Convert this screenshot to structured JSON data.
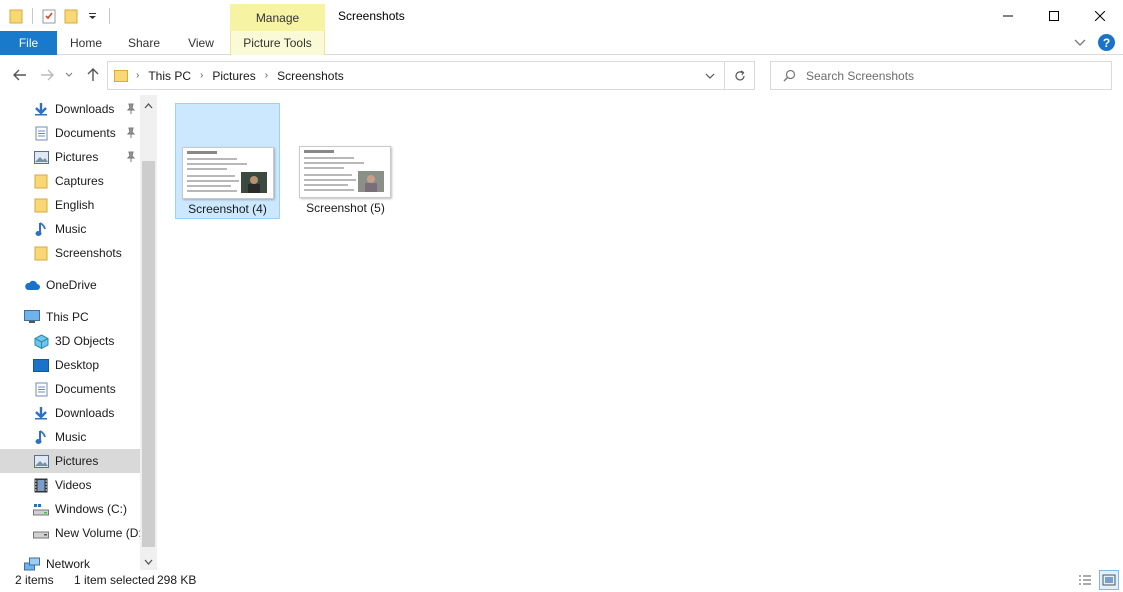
{
  "window": {
    "title": "Screenshots",
    "contextual_group": "Manage"
  },
  "ribbon": {
    "tabs": {
      "file": "File",
      "home": "Home",
      "share": "Share",
      "view": "View",
      "picture_tools": "Picture Tools"
    }
  },
  "address": {
    "crumbs": [
      "This PC",
      "Pictures",
      "Screenshots"
    ]
  },
  "search": {
    "placeholder": "Search Screenshots"
  },
  "sidebar": {
    "quick_access": [
      {
        "label": "Downloads",
        "icon": "download-arrow-icon",
        "pinned": true
      },
      {
        "label": "Documents",
        "icon": "document-icon",
        "pinned": true
      },
      {
        "label": "Pictures",
        "icon": "pictures-icon",
        "pinned": true
      },
      {
        "label": "Captures",
        "icon": "folder-icon",
        "pinned": false
      },
      {
        "label": "English",
        "icon": "folder-icon",
        "pinned": false
      },
      {
        "label": "Music",
        "icon": "music-note-icon",
        "pinned": false
      },
      {
        "label": "Screenshots",
        "icon": "folder-icon",
        "pinned": false
      }
    ],
    "onedrive": "OneDrive",
    "this_pc": "This PC",
    "this_pc_items": [
      {
        "label": "3D Objects",
        "icon": "cube-icon"
      },
      {
        "label": "Desktop",
        "icon": "desktop-icon"
      },
      {
        "label": "Documents",
        "icon": "document-icon"
      },
      {
        "label": "Downloads",
        "icon": "download-arrow-icon"
      },
      {
        "label": "Music",
        "icon": "music-note-icon"
      },
      {
        "label": "Pictures",
        "icon": "pictures-icon",
        "selected": true
      },
      {
        "label": "Videos",
        "icon": "film-icon"
      },
      {
        "label": "Windows (C:)",
        "icon": "drive-icon"
      },
      {
        "label": "New Volume (D:",
        "icon": "drive-icon"
      }
    ],
    "network": "Network"
  },
  "files": [
    {
      "name": "Screenshot (4)",
      "selected": true
    },
    {
      "name": "Screenshot (5)",
      "selected": false
    }
  ],
  "status": {
    "count": "2 items",
    "selected": "1 item selected",
    "size": "298 KB"
  },
  "colors": {
    "accent": "#1979ca",
    "manage_tab": "#f6f3a3",
    "selection": "#cce8ff",
    "folder": "#f8d775"
  }
}
